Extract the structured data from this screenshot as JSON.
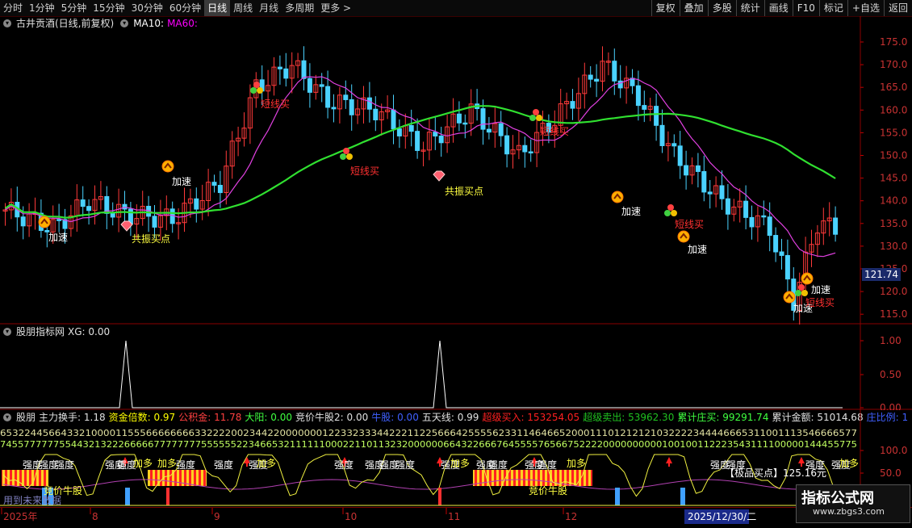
{
  "toolbar": {
    "periods": [
      "分时",
      "1分钟",
      "5分钟",
      "15分钟",
      "30分钟",
      "60分钟",
      "日线",
      "周线",
      "月线",
      "多周期",
      "更多 >"
    ],
    "active": "日线",
    "right_buttons": [
      "复权",
      "叠加",
      "多股",
      "统计",
      "画线",
      "F10",
      "标记",
      "+自选",
      "返回"
    ]
  },
  "main": {
    "title": "古井贡酒(日线,前复权)",
    "ma10_label": "MA10:",
    "ma60_label": "MA60:",
    "price_ticks": [
      "175.0",
      "170.0",
      "165.0",
      "160.0",
      "155.0",
      "150.0",
      "145.0",
      "140.0",
      "135.0",
      "130.0",
      "125.0",
      "120.0",
      "115.0"
    ],
    "current_price": "121.74",
    "annotations": {
      "jiasu": "加速",
      "gongzhen": "共振买点",
      "duanxian": "短线买"
    }
  },
  "indicator1": {
    "title": "股朋指标网",
    "xg_label": "XG: 0.00",
    "ticks": [
      "1.00",
      "0.50",
      "0.00"
    ]
  },
  "indicator2": {
    "name": "股朋",
    "items": [
      {
        "label": "主力换手:",
        "value": "1.18",
        "color": "#e0e0e0"
      },
      {
        "label": "资金倍数:",
        "value": "0.97",
        "color": "#ffff00"
      },
      {
        "label": "公积金:",
        "value": "11.78",
        "color": "#ff4040"
      },
      {
        "label": "大阳:",
        "value": "0.00",
        "color": "#40ff40"
      },
      {
        "label": "竞价牛股2:",
        "value": "0.00",
        "color": "#e0e0e0"
      },
      {
        "label": "牛股:",
        "value": "0.00",
        "color": "#4060ff"
      },
      {
        "label": "五天线:",
        "value": "0.99",
        "color": "#e0e0e0"
      },
      {
        "label": "超级买入:",
        "value": "153254.05",
        "color": "#ff2020"
      },
      {
        "label": "超级卖出:",
        "value": "53962.30",
        "color": "#20c020"
      },
      {
        "label": "累计庄买:",
        "value": "99291.74",
        "color": "#40ff40"
      },
      {
        "label": "累计金额:",
        "value": "51014.68",
        "color": "#e0e0e0"
      },
      {
        "label": "庄比例:",
        "value": "1",
        "color": "#4060ff"
      }
    ],
    "digits_row1": "653224456643321000011555666666663322220023442200000001223323334422211225666425555623311464665200011101212121032222344446665311001113546666577",
    "digits_row2": "7455777777554432132226666677777777555555223466532111111000221101132320000006643226667645555765667522220000000000100100112223543111100000144455775",
    "ticks": [
      "100.0",
      "50.0"
    ],
    "labels": {
      "qiangdu": "强度",
      "jiaduo": "加多",
      "jingjia": "竞价牛股",
      "jipin": "【极品买点】125.16元",
      "yongdao": "用到未来数据"
    }
  },
  "timeaxis": {
    "labels": [
      "2025年",
      "8",
      "9",
      "10",
      "11",
      "12"
    ],
    "cursor_date": "2025/12/30/二"
  },
  "watermark": {
    "main": "指标公式网",
    "sub": "www.zbgs3.com"
  }
}
